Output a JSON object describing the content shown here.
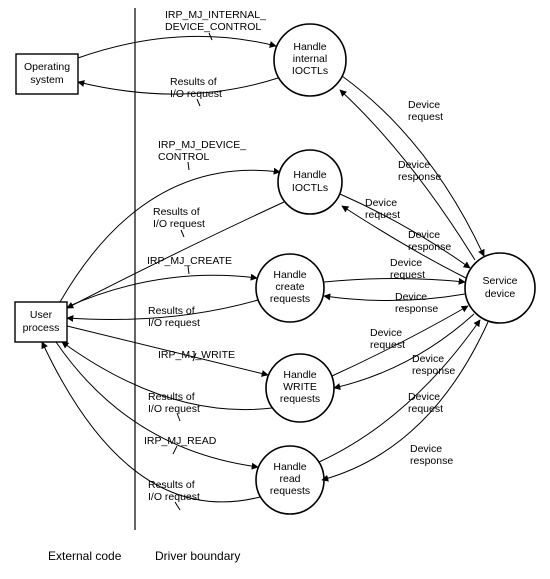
{
  "nodes": {
    "os": {
      "line1": "Operating",
      "line2": "system"
    },
    "user": {
      "line1": "User",
      "line2": "process"
    },
    "hint": {
      "line1": "Handle",
      "line2": "internal",
      "line3": "IOCTLs"
    },
    "hio": {
      "line1": "Handle",
      "line2": "IOCTLs"
    },
    "hcr": {
      "line1": "Handle",
      "line2": "create",
      "line3": "requests"
    },
    "hwr": {
      "line1": "Handle",
      "line2": "WRITE",
      "line3": "requests"
    },
    "hrd": {
      "line1": "Handle",
      "line2": "read",
      "line3": "requests"
    },
    "svc": {
      "line1": "Service",
      "line2": "device"
    }
  },
  "labels": {
    "irp_internal": {
      "l1": "IRP_MJ_INTERNAL_",
      "l2": "DEVICE_CONTROL"
    },
    "irp_devctl": {
      "l1": "IRP_MJ_DEVICE_",
      "l2": "CONTROL"
    },
    "irp_create": "IRP_MJ_CREATE",
    "irp_write": "IRP_MJ_WRITE",
    "irp_read": "IRP_MJ_READ",
    "results1": {
      "l1": "Results of",
      "l2": "I/O request"
    },
    "results2": {
      "l1": "Results of",
      "l2": "I/O request"
    },
    "results3": {
      "l1": "Results of",
      "l2": "I/O request"
    },
    "results4": {
      "l1": "Results of",
      "l2": "I/O request"
    },
    "results5": {
      "l1": "Results of",
      "l2": "I/O request"
    },
    "dreq1": {
      "l1": "Device",
      "l2": "request"
    },
    "dreq2": {
      "l1": "Device",
      "l2": "request"
    },
    "dreq3": {
      "l1": "Device",
      "l2": "request"
    },
    "dreq4": {
      "l1": "Device",
      "l2": "request"
    },
    "dreq5": {
      "l1": "Device",
      "l2": "request"
    },
    "dresp1": {
      "l1": "Device",
      "l2": "response"
    },
    "dresp2": {
      "l1": "Device",
      "l2": "response"
    },
    "dresp3": {
      "l1": "Device",
      "l2": "response"
    },
    "dresp4": {
      "l1": "Device",
      "l2": "response"
    },
    "dresp5": {
      "l1": "Device",
      "l2": "response"
    }
  },
  "regions": {
    "external": "External code",
    "driver": "Driver boundary"
  }
}
